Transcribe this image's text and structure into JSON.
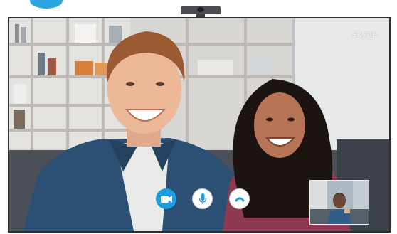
{
  "app": {
    "brand": "skype"
  },
  "call_controls": [
    {
      "icon": "video-camera-icon",
      "state": "on"
    },
    {
      "icon": "microphone-icon",
      "state": "on"
    },
    {
      "icon": "end-call-icon",
      "state": "available"
    }
  ],
  "colors": {
    "accent": "#1a9ee0",
    "control_background": "#ffffff",
    "tv_bezel": "#2c2e31"
  }
}
